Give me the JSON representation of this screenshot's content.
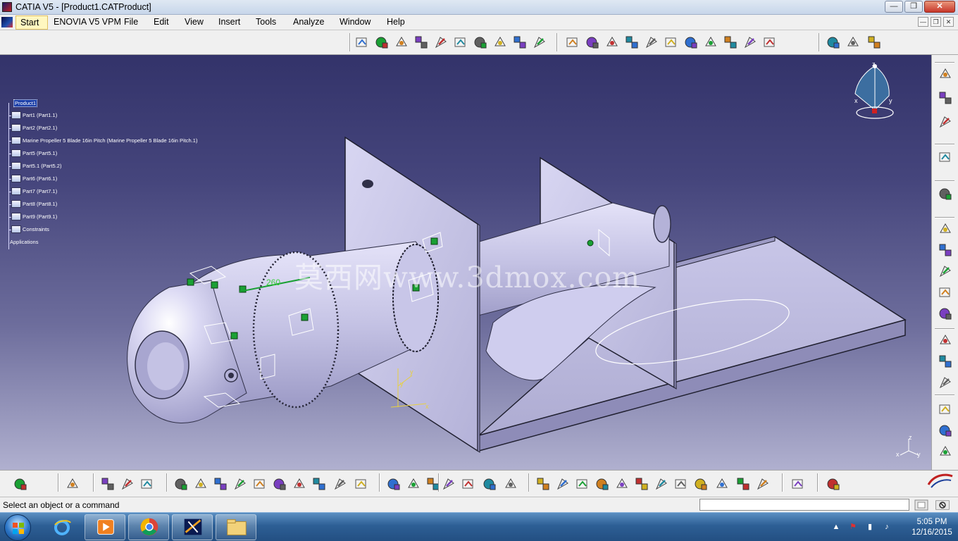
{
  "window": {
    "title": "CATIA V5 - [Product1.CATProduct]",
    "minimize_glyph": "—",
    "maximize_glyph": "❐",
    "close_glyph": "✕"
  },
  "menu": {
    "items": [
      "Start",
      "ENOVIA V5 VPM",
      "File",
      "Edit",
      "View",
      "Insert",
      "Tools",
      "Analyze",
      "Window",
      "Help"
    ],
    "doc_min_glyph": "—",
    "doc_restore_glyph": "❐",
    "doc_close_glyph": "✕"
  },
  "tree": {
    "root": "Product1",
    "children": [
      "Part1 (Part1.1)",
      "Part2 (Part2.1)",
      "Marine Propeller 5 Blade 16in Pitch (Marine Propeller 5 Blade 16in Pitch.1)",
      "Part5 (Part5.1)",
      "Part5.1 (Part5.2)",
      "Part6 (Part6.1)",
      "Part7 (Part7.1)",
      "Part8 (Part8.1)",
      "Part9 (Part9.1)",
      "Constraints"
    ],
    "applications": "Applications"
  },
  "viewport": {
    "watermark": "莫西网www.3dmox.com",
    "dimension": "260",
    "compass_x": "x",
    "compass_y": "y",
    "compass_z": "z",
    "axis_y1": "y",
    "axis_x1": "x",
    "axis_y2": "y",
    "axis_z": "z",
    "axis_x2": "x",
    "axis_y3": "y"
  },
  "toolbar_top_icons": [
    "manipulation-icon",
    "explode-icon",
    "stop-manipulate-icon",
    "clash-icon",
    "sectioning-icon",
    "measure-icon",
    "catalog-icon",
    "update-icon",
    "sketcher-icon",
    "product-icon",
    "component-icon",
    "part-icon",
    "existing-component-icon",
    "replace-icon",
    "reorder-icon",
    "generate-numbering-icon",
    "annotation-icon",
    "bill-of-material-icon",
    "scene-icon",
    "publication-icon",
    "fit-all-icon",
    "pan-icon",
    "zoom-icon",
    "axis-icon"
  ],
  "toolbar_right_icons": [
    "assembly-icon",
    "constraint-icon",
    "fix-icon",
    "select-icon",
    "snap-icon",
    "coincidence-icon",
    "contact-icon",
    "offset-icon",
    "angle-icon",
    "rotate-component-icon",
    "move-icon",
    "smart-move-icon",
    "reuse-pattern-icon",
    "bolt-icon",
    "flexible-icon",
    "multi-instantiate-icon",
    "fast-multi-instantiate-icon"
  ],
  "toolbar_bottom_icons": [
    "capture-icon",
    "grid-icon",
    "material-icon",
    "render-icon",
    "apply-material-icon",
    "new-icon",
    "open-icon",
    "save-icon",
    "print-icon",
    "cut-icon",
    "copy-icon",
    "paste-icon",
    "undo-icon",
    "redo-icon",
    "whats-this-icon",
    "formula-icon",
    "comment-icon",
    "knowledge-icon",
    "table-icon",
    "spec-tree-icon",
    "measure-item-icon",
    "catalog-browser-icon",
    "fly-mode-icon",
    "fit-all-bottom-icon",
    "pan-bottom-icon",
    "rotate-icon",
    "zoom-in-icon",
    "zoom-out-icon",
    "normal-view-icon",
    "iso-view-icon",
    "shading-icon",
    "hide-show-icon",
    "swap-icon",
    "create-multi-view-icon",
    "view-mode-icon",
    "reload-icon"
  ],
  "status": {
    "text": "Select an object or a command",
    "command_placeholder": ""
  },
  "taskbar": {
    "time": "5:05 PM",
    "date": "12/16/2015",
    "apps": [
      "internet-explorer-icon",
      "media-player-icon",
      "chrome-icon",
      "catia-task-icon",
      "file-explorer-icon"
    ]
  },
  "colors": {
    "viewport_top": "#33336a",
    "viewport_bottom": "#b0b0cf",
    "model": "#c6c4e6",
    "constraint_green": "#1aa034",
    "taskbar": "#2d5f95"
  }
}
